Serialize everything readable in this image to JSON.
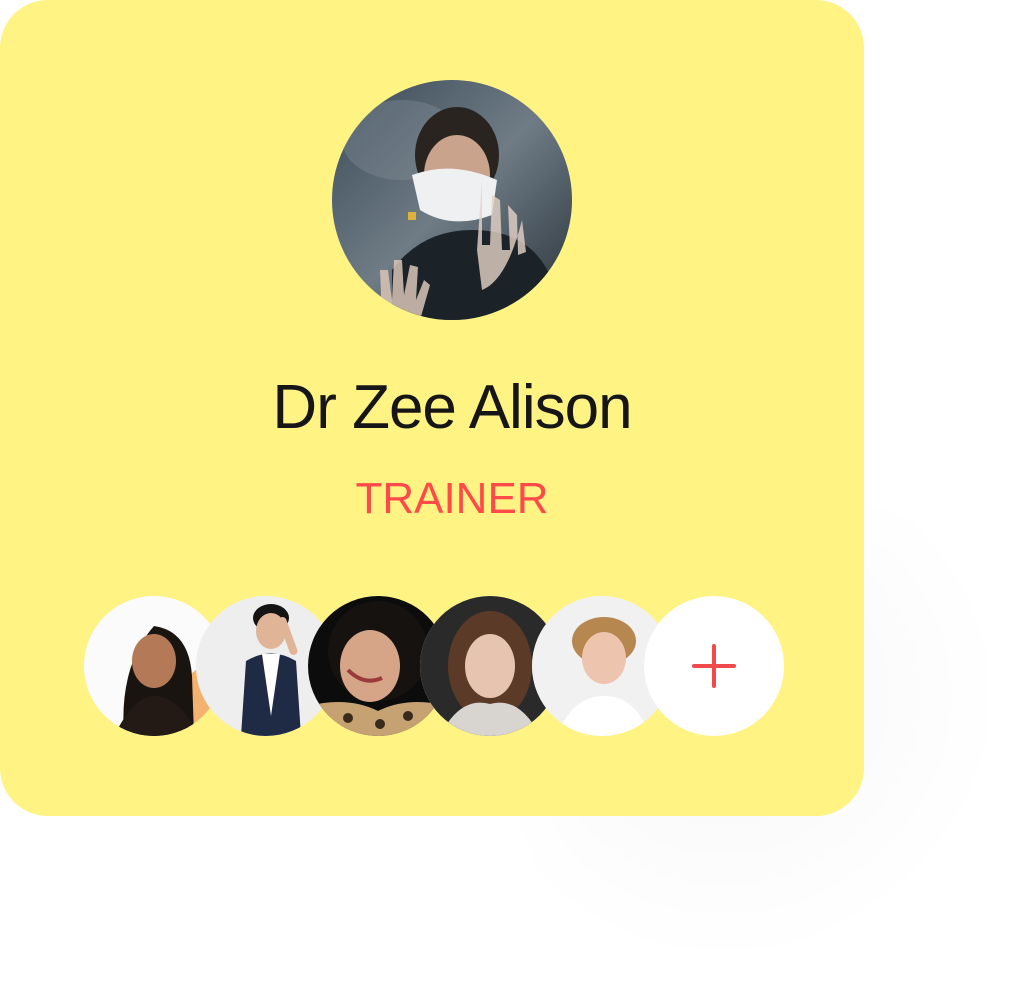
{
  "profile": {
    "name": "Dr Zee Alison",
    "role": "TRAINER",
    "avatar_icon": "person-photo-masked"
  },
  "members": {
    "avatars": [
      {
        "icon": "person-photo-1"
      },
      {
        "icon": "person-photo-2"
      },
      {
        "icon": "person-photo-3"
      },
      {
        "icon": "person-photo-4"
      },
      {
        "icon": "person-photo-5"
      }
    ],
    "add_icon": "plus-icon"
  },
  "colors": {
    "card_background": "#fff384",
    "accent_red": "#ff4a4a",
    "name_text": "#161616"
  }
}
